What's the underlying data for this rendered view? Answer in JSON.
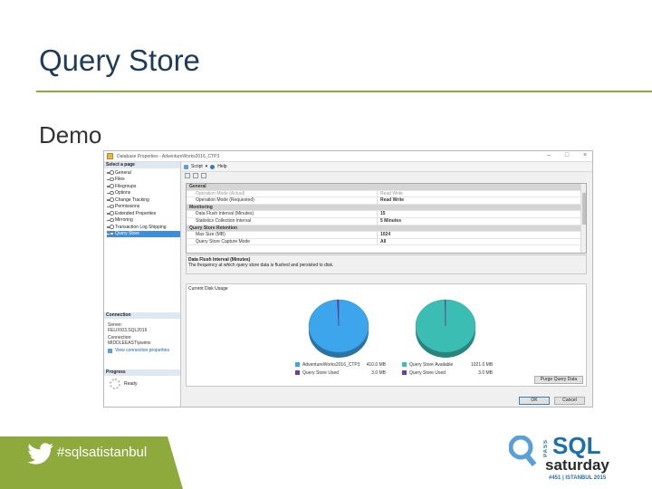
{
  "slide": {
    "title": "Query Store",
    "subtitle": "Demo",
    "hashtag": "#sqlsatistanbul",
    "logo": {
      "pass": "PASS",
      "sql": "SQL",
      "saturday": "saturday",
      "event": "#451 | ISTANBUL 2015"
    }
  },
  "dialog": {
    "window_title": "Database Properties - AdventureWorks2016_CTP3",
    "left": {
      "select_page": "Select a page",
      "pages": [
        "General",
        "Files",
        "Filegroups",
        "Options",
        "Change Tracking",
        "Permissions",
        "Extended Properties",
        "Mirroring",
        "Transaction Log Shipping",
        "Query Store"
      ],
      "active_page": "Query Store",
      "connection_header": "Connection",
      "server_label": "Server:",
      "server_value": "FELIX\\03.SQL2016",
      "connection_label": "Connection:",
      "connection_value": "MIDDLEEAST\\pwims",
      "view_conn": "View connection properties",
      "progress_header": "Progress",
      "ready": "Ready"
    },
    "toolbar": {
      "script": "Script",
      "help": "Help"
    },
    "grid": {
      "rows": [
        {
          "type": "cat",
          "key": "General",
          "value": ""
        },
        {
          "type": "disabled",
          "key": "Operation Mode (Actual)",
          "value": "Read Write"
        },
        {
          "type": "bold",
          "key": "Operation Mode (Requested)",
          "value": "Read Write"
        },
        {
          "type": "cat",
          "key": "Monitoring",
          "value": ""
        },
        {
          "type": "bold",
          "key": "Data Flush Interval (Minutes)",
          "value": "15"
        },
        {
          "type": "bold",
          "key": "Statistics Collection Interval",
          "value": "5 Minutes"
        },
        {
          "type": "cat",
          "key": "Query Store Retention",
          "value": ""
        },
        {
          "type": "bold",
          "key": "Max Size (MB)",
          "value": "1024"
        },
        {
          "type": "bold",
          "key": "Query Store Capture Mode",
          "value": "All"
        }
      ]
    },
    "description": {
      "title": "Data Flush Interval (Minutes)",
      "text": "The frequency at which query store data is flushed and persisted to disk."
    },
    "usage": {
      "label": "Current Disk Usage",
      "legend1": [
        {
          "name": "AdventureWorks2016_CTP3",
          "value": "410.0 MB",
          "color": "#3da5ec"
        },
        {
          "name": "Query Store Used",
          "value": "3.0 MB",
          "color": "#6a3da8"
        }
      ],
      "legend2": [
        {
          "name": "Query Store Available",
          "value": "1021.0 MB",
          "color": "#3bbdb4"
        },
        {
          "name": "Query Store Used",
          "value": "3.0 MB",
          "color": "#6a3da8"
        }
      ],
      "purge": "Purge Query Data"
    },
    "buttons": {
      "ok": "OK",
      "cancel": "Cancel"
    }
  },
  "chart_data": [
    {
      "type": "pie",
      "categories": [
        "AdventureWorks2016_CTP3",
        "Query Store Used"
      ],
      "values": [
        410.0,
        3.0
      ],
      "colors": [
        "#3da5ec",
        "#6a3da8"
      ],
      "unit": "MB"
    },
    {
      "type": "pie",
      "categories": [
        "Query Store Available",
        "Query Store Used"
      ],
      "values": [
        1021.0,
        3.0
      ],
      "colors": [
        "#3bbdb4",
        "#6a3da8"
      ],
      "unit": "MB"
    }
  ],
  "colors": {
    "title": "#1f3b57",
    "rule": "#8faa3c",
    "footer": "#8faa3c",
    "logo_blue": "#1e6fa8"
  }
}
